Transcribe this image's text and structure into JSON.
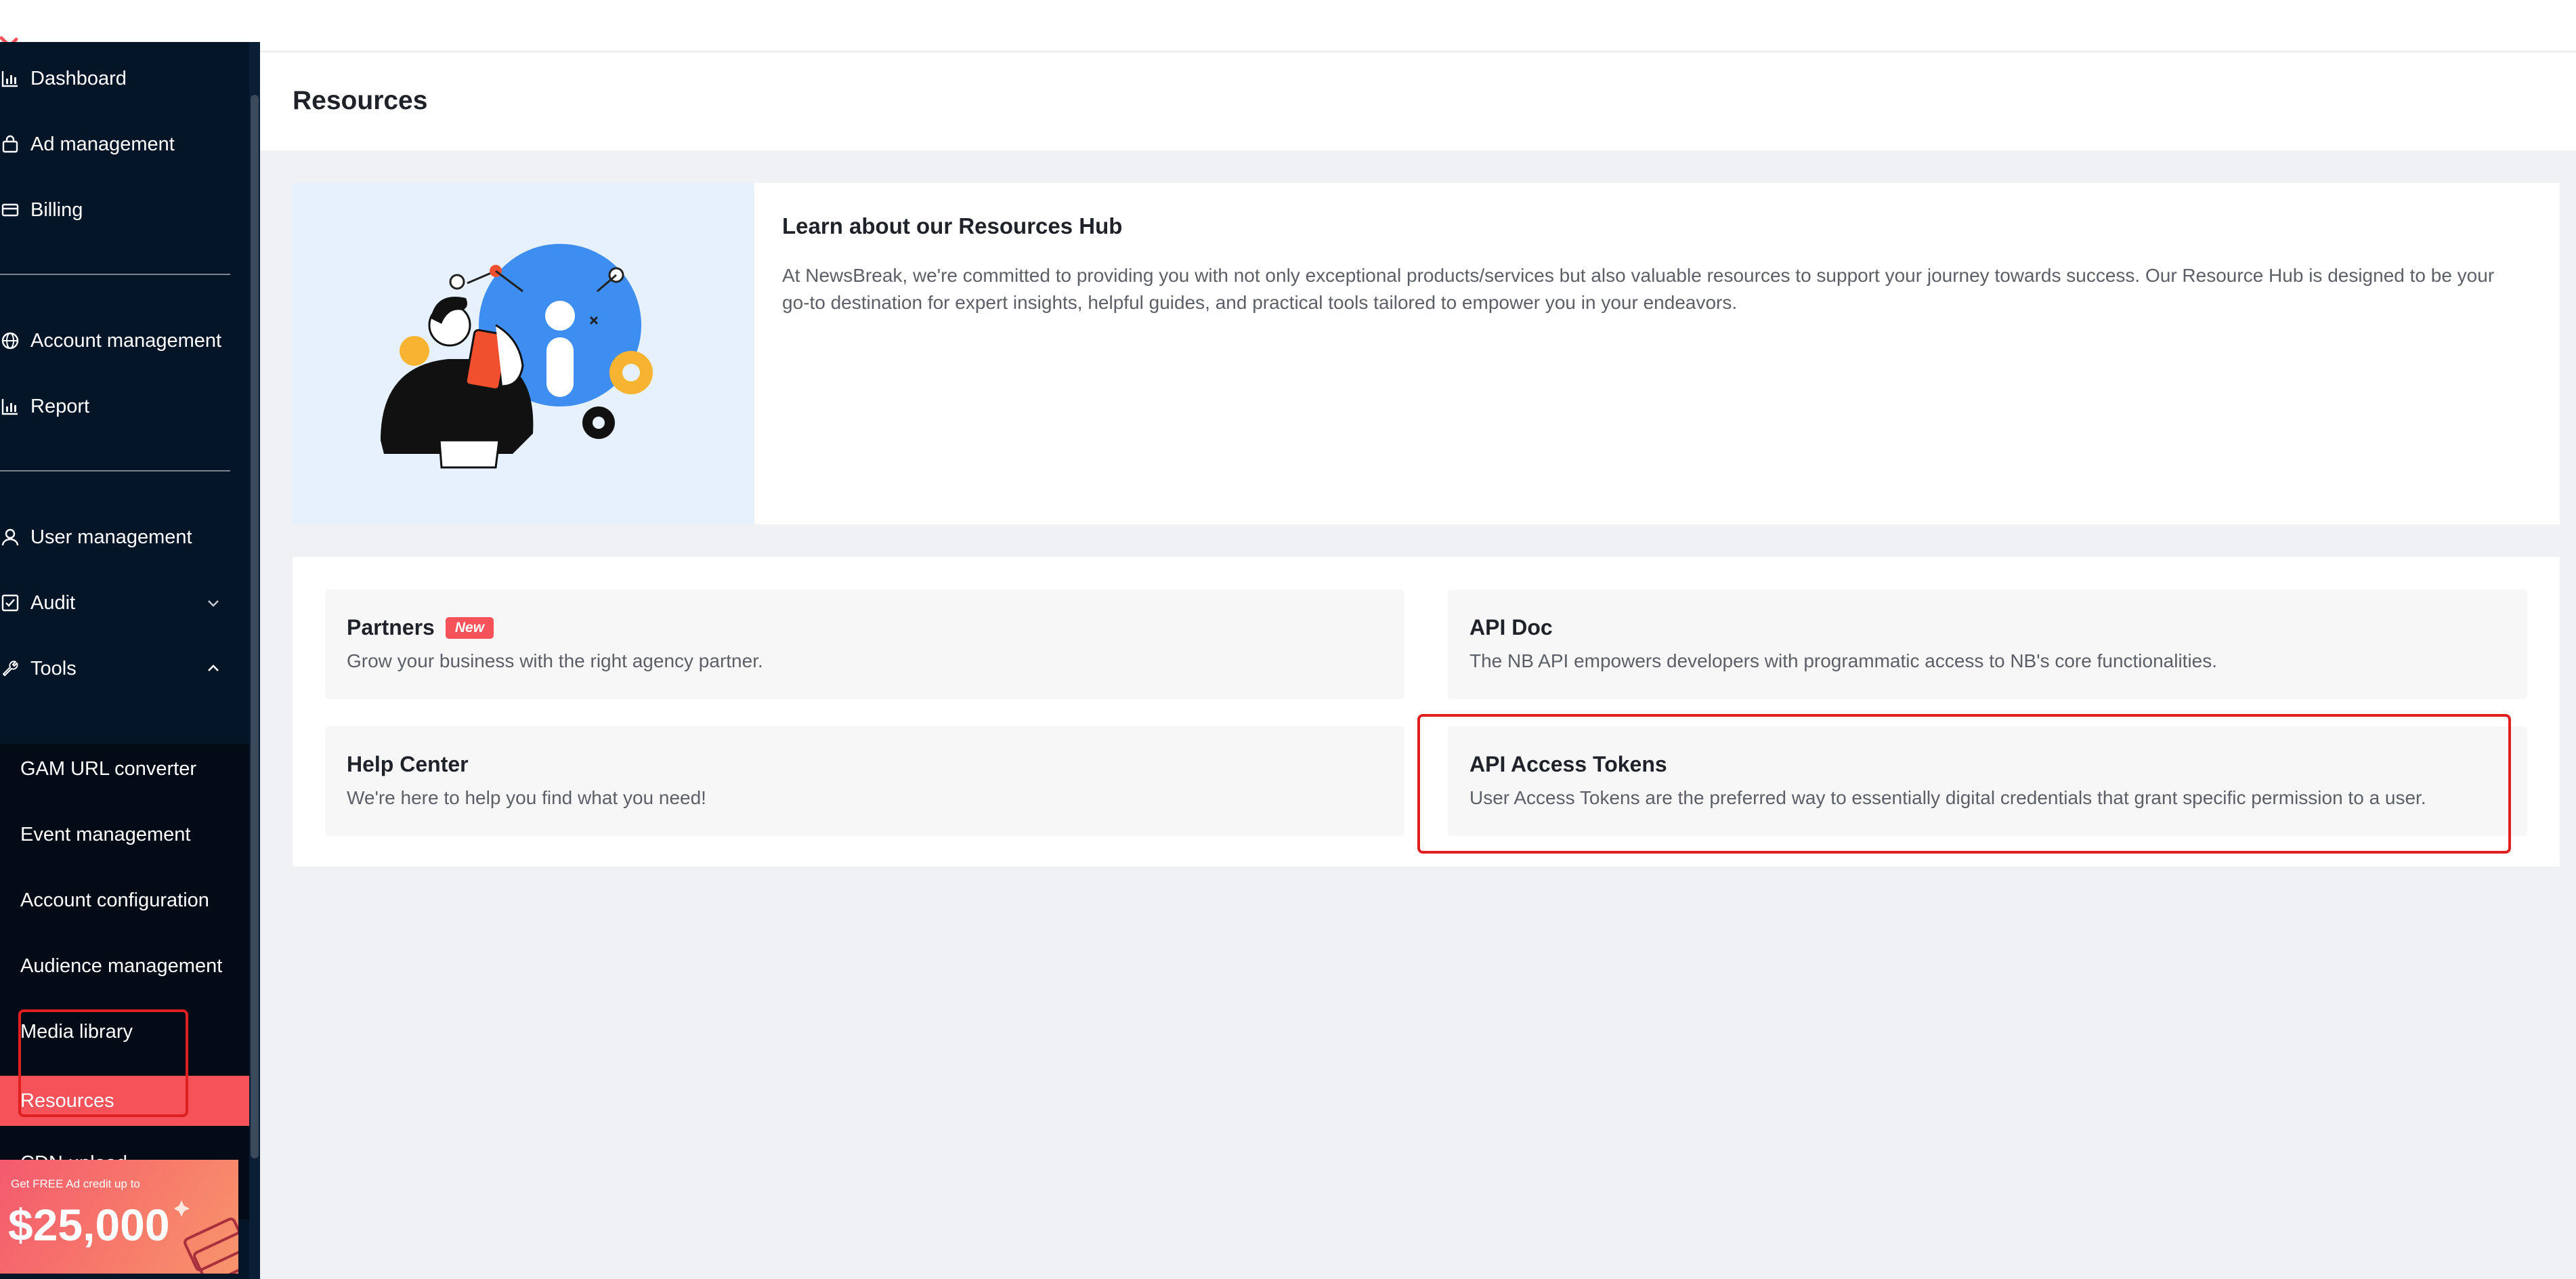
{
  "sidebar": {
    "nav": [
      {
        "label": "Dashboard",
        "icon": "bar-chart-icon"
      },
      {
        "label": "Ad management",
        "icon": "shopping-bag-icon"
      },
      {
        "label": "Billing",
        "icon": "credit-card-icon"
      },
      {
        "label": "Account management",
        "icon": "globe-icon"
      },
      {
        "label": "Report",
        "icon": "bar-chart-icon"
      },
      {
        "label": "User management",
        "icon": "user-icon"
      },
      {
        "label": "Audit",
        "icon": "checkbox-icon",
        "expanded": false
      },
      {
        "label": "Tools",
        "icon": "wrench-icon",
        "expanded": true
      }
    ],
    "tools_submenu": [
      {
        "label": "GAM URL converter"
      },
      {
        "label": "Event management"
      },
      {
        "label": "Account configuration"
      },
      {
        "label": "Audience management"
      },
      {
        "label": "Media library"
      },
      {
        "label": "Resources",
        "active": true
      },
      {
        "label": "CDN upload"
      }
    ],
    "promo": {
      "small_text": "Get FREE Ad credit up to",
      "amount": "$25,000"
    }
  },
  "page": {
    "title": "Resources"
  },
  "hero": {
    "title": "Learn about our Resources Hub",
    "description": "At NewsBreak, we're committed to providing you with not only exceptional products/services but also valuable resources to support your journey towards success. Our Resource Hub is designed to be your go-to destination for expert insights, helpful guides, and practical tools tailored to empower you in your endeavors."
  },
  "cards": [
    {
      "title": "Partners",
      "badge": "New",
      "description": "Grow your business with the right agency partner."
    },
    {
      "title": "API Doc",
      "description": "The NB API empowers developers with programmatic access to NB's core functionalities."
    },
    {
      "title": "Help Center",
      "description": "We're here to help you find what you need!"
    },
    {
      "title": "API Access Tokens",
      "description": "User Access Tokens are the preferred way to essentially digital credentials that grant specific permission to a user."
    }
  ],
  "colors": {
    "sidebar_bg": "#051528",
    "submenu_bg": "#020b16",
    "accent": "#f5525a",
    "page_bg": "#f0f1f4",
    "highlight": "#e02020"
  }
}
